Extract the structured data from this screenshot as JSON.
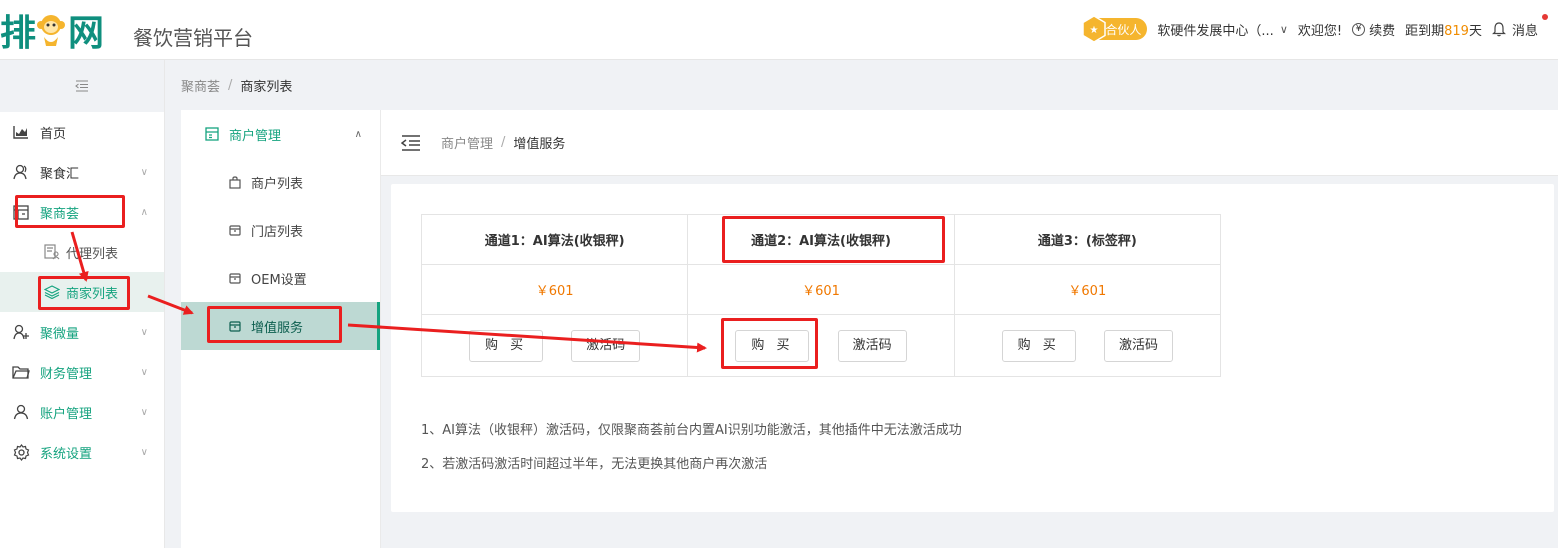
{
  "header": {
    "logo_text_1": "排",
    "logo_text_2": "网",
    "platform": "餐饮营销平台",
    "partner_badge": "合伙人",
    "org_name": "软硬件发展中心（...",
    "welcome": "欢迎您!",
    "renew_label": "续费",
    "expire_prefix": "距到期",
    "expire_days": "819",
    "expire_suffix": "天",
    "messages": "消息"
  },
  "sidebar": {
    "collapse_icon": "collapse-icon",
    "items": [
      {
        "label": "首页",
        "icon": "chart-icon"
      },
      {
        "label": "聚食汇",
        "icon": "user-icon"
      },
      {
        "label": "聚商荟",
        "icon": "store-icon"
      },
      {
        "label": "代理列表",
        "icon": "document-user-icon"
      },
      {
        "label": "商家列表",
        "icon": "layers-icon"
      },
      {
        "label": "聚微量",
        "icon": "user-plus-icon"
      },
      {
        "label": "财务管理",
        "icon": "folder-icon"
      },
      {
        "label": "账户管理",
        "icon": "person-icon"
      },
      {
        "label": "系统设置",
        "icon": "gear-icon"
      }
    ]
  },
  "breadcrumb": {
    "parent": "聚商荟",
    "current": "商家列表"
  },
  "sub_sidebar": {
    "group": "商户管理",
    "items": [
      "商户列表",
      "门店列表",
      "OEM设置",
      "增值服务"
    ]
  },
  "content_breadcrumb": {
    "parent": "商户管理",
    "current": "增值服务"
  },
  "services": {
    "columns": [
      {
        "title": "通道1：AI算法(收银秤)",
        "price": "￥601",
        "buy": "购 买",
        "code": "激活码"
      },
      {
        "title": "通道2：AI算法(收银秤)",
        "price": "￥601",
        "buy": "购 买",
        "code": "激活码"
      },
      {
        "title": "通道3：(标签秤)",
        "price": "￥601",
        "buy": "购 买",
        "code": "激活码"
      }
    ]
  },
  "notes": [
    "1、AI算法（收银秤）激活码，仅限聚商荟前台内置AI识别功能激活，其他插件中无法激活成功",
    "2、若激活码激活时间超过半年，无法更换其他商户再次激活"
  ],
  "colors": {
    "brand": "#15a37f",
    "price": "#f07800",
    "annotation": "#ea1f1f"
  }
}
